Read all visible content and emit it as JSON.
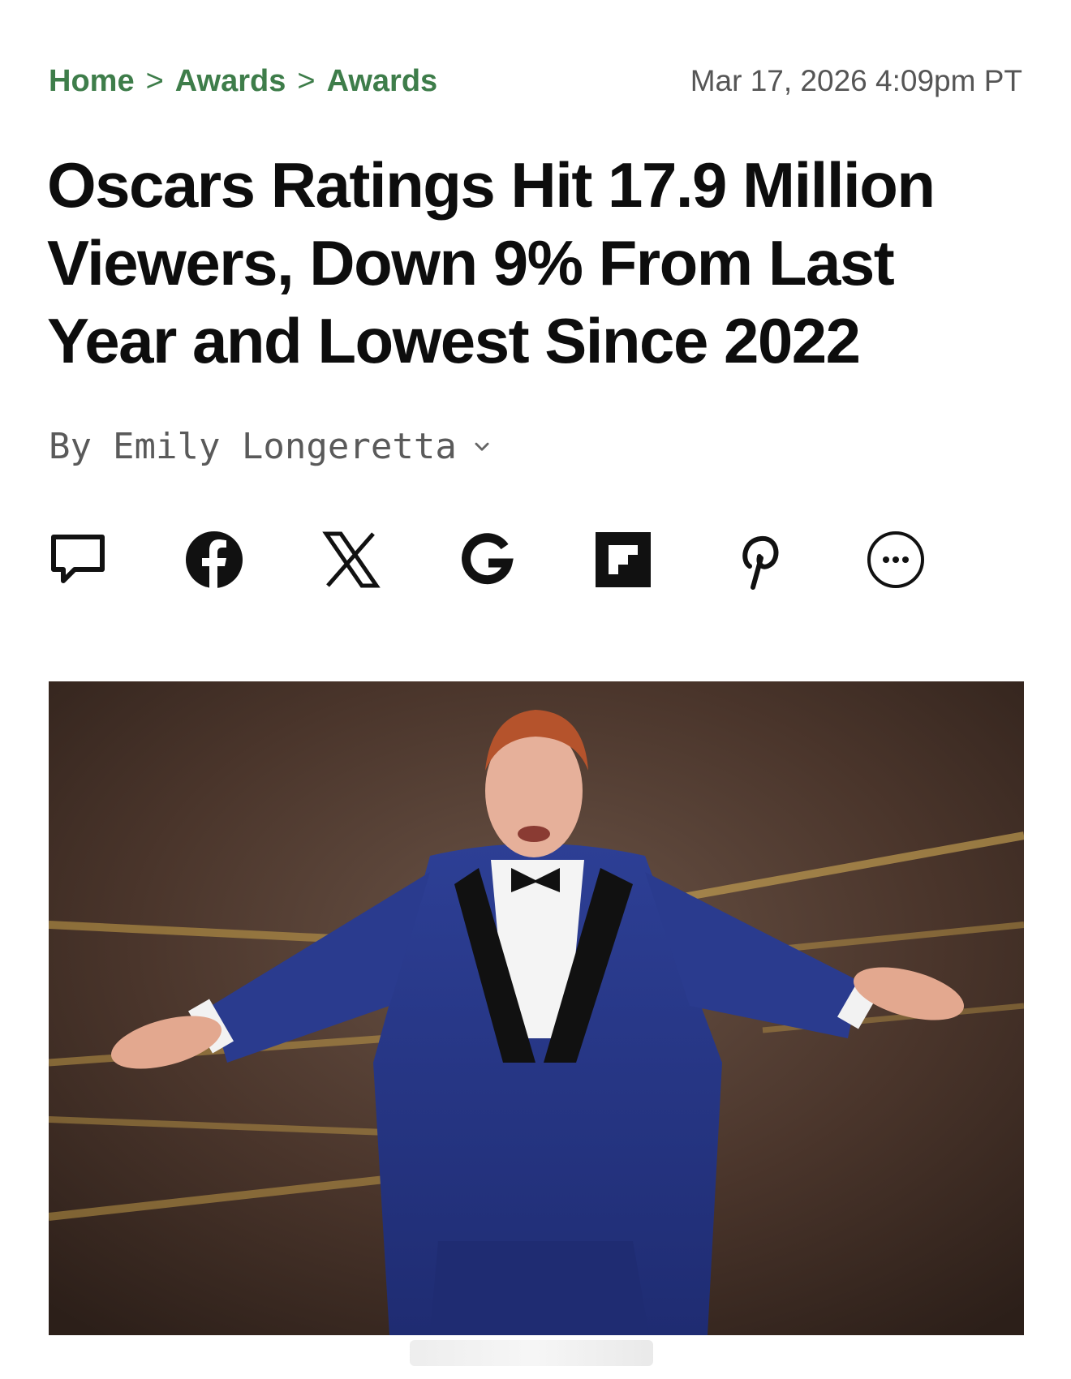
{
  "breadcrumb": {
    "items": [
      "Home",
      "Awards",
      "Awards"
    ],
    "separator": ">"
  },
  "timestamp": "Mar 17, 2026 4:09pm PT",
  "headline": "Oscars Ratings Hit 17.9 Million Viewers, Down 9% From Last Year and Lowest Since 2022",
  "byline": {
    "prefix": "By",
    "author": "Emily Longeretta"
  },
  "share_icons": [
    "comment-icon",
    "facebook-icon",
    "x-icon",
    "google-icon",
    "flipboard-icon",
    "pinterest-icon",
    "more-icon"
  ],
  "colors": {
    "breadcrumb": "#3e7d4a",
    "headline": "#0d0d0d",
    "meta": "#555555"
  },
  "photo": {
    "subject": "host in blue tuxedo with arms outstretched on stage"
  }
}
